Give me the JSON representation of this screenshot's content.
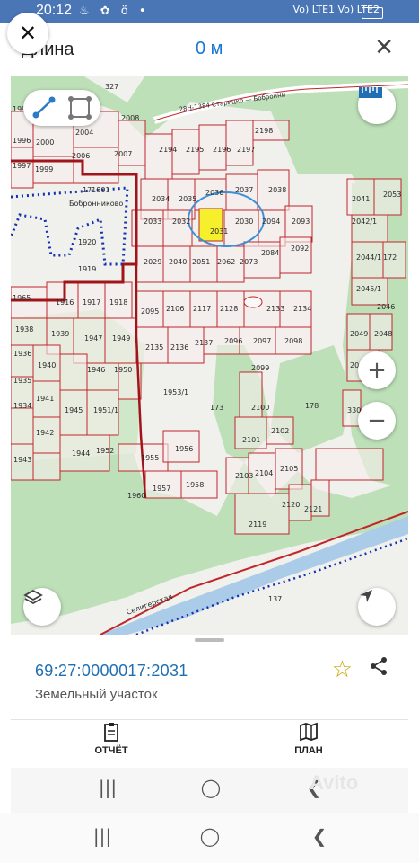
{
  "status_bar": {
    "time": "20:12",
    "notification_icons": "♨ ✿ ö •",
    "system_text": "Vo) LTE1 Vo) LTE2"
  },
  "top_bar": {
    "title": "Длина",
    "distance": "0 м",
    "close_glyph": "✕"
  },
  "map": {
    "colors": {
      "land": "#f0f0ec",
      "forest": "#bde0b8",
      "parcel_line": "#c0262b",
      "selected": "#f5ef2c",
      "river": "#aacce8",
      "boundary_dots": "#1530b0"
    },
    "parcels_top": [
      "1995",
      "327",
      "2008",
      "2004",
      "1996",
      "1997",
      "2000",
      "2006",
      "2007",
      "1999",
      "2194",
      "2195",
      "2196",
      "2197",
      "2198"
    ],
    "parcels_mid": [
      "2034",
      "2035",
      "2036",
      "2037",
      "2038",
      "2033",
      "2032",
      "2031",
      "2030",
      "2094",
      "2093",
      "2029",
      "2040",
      "2051",
      "2062",
      "2073",
      "2084",
      "2092",
      "2041",
      "2053",
      "2042/1",
      "2044/1",
      "2045/1",
      "172",
      "2046"
    ],
    "parcels_lower": [
      "1965",
      "1916",
      "1917",
      "1918",
      "2095",
      "2106",
      "2117",
      "2128",
      "2133",
      "2134",
      "1938",
      "1939",
      "1947",
      "1949",
      "2135",
      "2136",
      "2137",
      "2096",
      "2097",
      "2098",
      "2049",
      "2048",
      "1936",
      "1940",
      "1946",
      "1950",
      "1953/1",
      "2099",
      "2050",
      "1935",
      "1941",
      "1934",
      "1945",
      "1951/1",
      "173",
      "2100",
      "178",
      "330",
      "1942",
      "1952",
      "1956",
      "2101",
      "2102",
      "1943",
      "1944",
      "1955",
      "2103",
      "2104",
      "2105",
      "1960",
      "1957",
      "1958",
      "2120",
      "2121",
      "2119",
      "137"
    ],
    "labels": [
      "171801",
      "Бобронникоо",
      "1920",
      "1919",
      "Бобронни",
      "Селигерская"
    ],
    "road_label": "28Н-1384 Старицко — Бобронни"
  },
  "selected_parcel": {
    "cadastral_number": "69:27:0000017:2031",
    "type": "Земельный участок"
  },
  "tabs": [
    {
      "label": "ОТЧЁТ",
      "icon": "clipboard-icon"
    },
    {
      "label": "ПЛАН",
      "icon": "map-icon"
    }
  ],
  "watermark": "Avito",
  "nav_buttons": [
    "recents-icon",
    "home-icon",
    "back-icon"
  ]
}
